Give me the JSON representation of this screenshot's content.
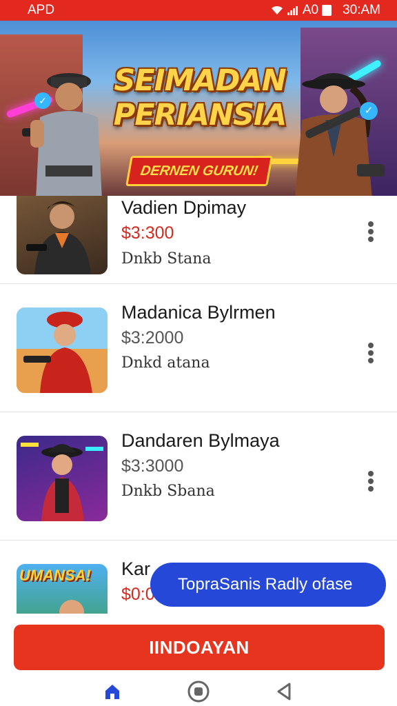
{
  "status_bar": {
    "carrier": "APD",
    "network": "A0",
    "time": "30:AM",
    "icons": [
      "wifi-icon",
      "signal-icon",
      "battery-icon"
    ]
  },
  "banner": {
    "title_line1": "SEIMADAN",
    "title_line2": "PERIANSIA",
    "subtitle": "DERNEN GURUN!"
  },
  "list": {
    "items": [
      {
        "title": "Vadien Dpimay",
        "price": "$3:300",
        "status": "Dnkb Stana",
        "price_color": "#d42a1e"
      },
      {
        "title": "Madanica Bylrmen",
        "price": "$3:2000",
        "status": "Dnkd atana",
        "price_color": "#555555"
      },
      {
        "title": "Dandaren Bylmaya",
        "price": "$3:3000",
        "status": "Dnkb Sbana",
        "price_color": "#555555"
      },
      {
        "title": "Kar",
        "price": "$0:0",
        "status": "",
        "price_color": "#d42a1e",
        "thumb_text": "UMANSA!"
      }
    ]
  },
  "toast": {
    "message": "TopraSanis Radly ofase"
  },
  "cta": {
    "label": "IINDOAYAN"
  },
  "nav": {
    "items": [
      "home-icon",
      "circle-icon",
      "back-icon"
    ]
  },
  "colors": {
    "accent": "#e3281f",
    "toast": "#2548d9",
    "nav_active": "#2548d9"
  }
}
